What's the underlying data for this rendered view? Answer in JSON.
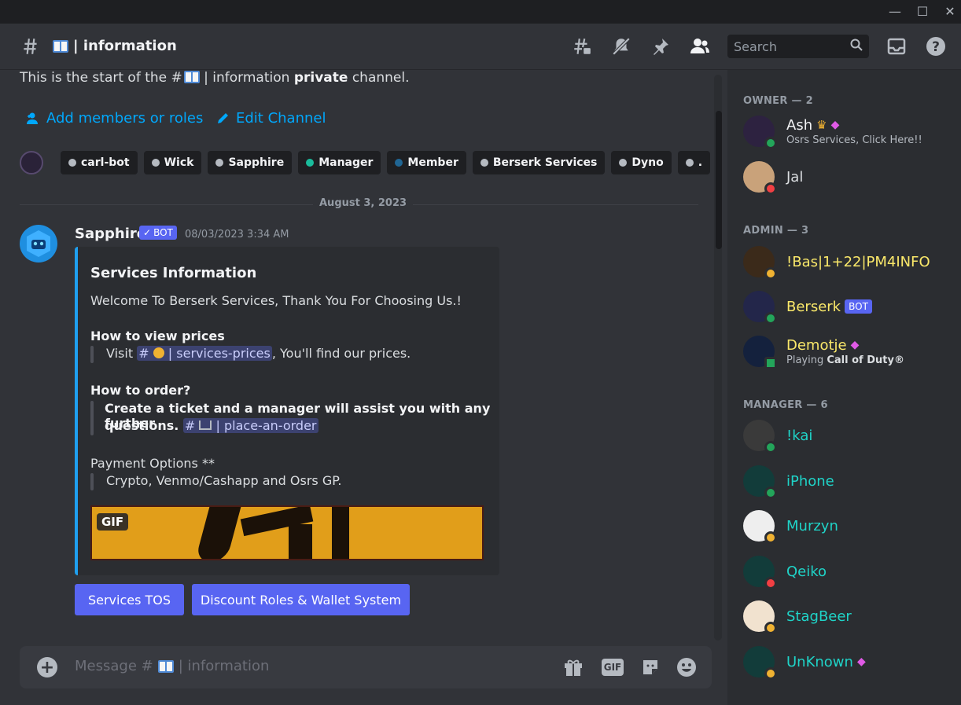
{
  "window": {
    "minimize_icon": "minimize-icon",
    "maximize_icon": "maximize-icon",
    "close_icon": "close-icon"
  },
  "header": {
    "channel_icon": "hashtag-lock-icon",
    "channel_name": "| information",
    "icons": [
      "threads-icon",
      "mute-bell-icon",
      "pin-icon",
      "members-icon"
    ],
    "search_placeholder": "Search",
    "inbox_icon": "inbox-icon",
    "help_icon": "help-icon"
  },
  "intro": {
    "prefix": "This is the start of the #",
    "middle": " | information ",
    "bold": "private",
    "suffix": " channel.",
    "add_members": "Add members or roles",
    "edit_channel": "Edit Channel"
  },
  "roles": [
    {
      "label": "carl-bot",
      "color": "#b5bac1"
    },
    {
      "label": "Wick",
      "color": "#b5bac1"
    },
    {
      "label": "Sapphire",
      "color": "#b5bac1"
    },
    {
      "label": "Manager",
      "color": "#1abc9c"
    },
    {
      "label": "Member",
      "color": "#206694"
    },
    {
      "label": "Berserk Services",
      "color": "#b5bac1"
    },
    {
      "label": "Dyno",
      "color": "#b5bac1"
    },
    {
      "label": ".",
      "color": "#b5bac1"
    }
  ],
  "divider_date": "August 3, 2023",
  "message": {
    "author": "Sapphire",
    "bot_tag": "BOT",
    "timestamp": "08/03/2023 3:34 AM",
    "embed": {
      "title": "Services Information",
      "welcome": "Welcome To Berserk Services, Thank You For Choosing Us.!",
      "prices_heading": "How to view prices",
      "prices_visit": "Visit",
      "prices_channel": "| services-prices",
      "prices_suffix": ", You'll find our prices.",
      "order_heading": "How to order?",
      "order_line1": "Create a ticket and a manager will assist you with any further",
      "order_line2": "questions.",
      "order_channel": "| place-an-order",
      "payment_heading": "Payment Options **",
      "payment_text": "Crypto, Venmo/Cashapp and Osrs GP.",
      "gif_label": "GIF"
    },
    "buttons": [
      "Services TOS",
      "Discount Roles & Wallet System"
    ]
  },
  "composer": {
    "placeholder_prefix": "Message #",
    "placeholder_suffix": "| information",
    "icons": [
      "gift-icon",
      "gif-icon",
      "sticker-icon",
      "emoji-icon"
    ],
    "gif_text": "GIF"
  },
  "members": {
    "groups": [
      {
        "label": "OWNER — 2",
        "members": [
          {
            "name": "Ash",
            "color": "#f2f3f5",
            "sub": "Osrs Services, Click Here!!",
            "status": "online",
            "badges": [
              "crown",
              "gem"
            ]
          },
          {
            "name": "Jal",
            "color": "#dbdee1",
            "sub": "",
            "status": "dnd",
            "badges": []
          }
        ]
      },
      {
        "label": "ADMIN — 3",
        "members": [
          {
            "name": "!Bas|1+22|PM4INFO",
            "color": "#fbe96a",
            "sub": "",
            "status": "idle",
            "badges": []
          },
          {
            "name": "Berserk",
            "color": "#fbe96a",
            "sub": "",
            "status": "online",
            "badges": [
              "bot"
            ]
          },
          {
            "name": "Demotje",
            "color": "#fbe96a",
            "sub_prefix": "Playing ",
            "sub_bold": "Call of Duty®",
            "status": "mobile",
            "badges": [
              "gem"
            ]
          }
        ]
      },
      {
        "label": "MANAGER — 6",
        "members": [
          {
            "name": "!kai",
            "color": "#1fd4c8",
            "status": "online"
          },
          {
            "name": "iPhone",
            "color": "#1fd4c8",
            "status": "online"
          },
          {
            "name": "Murzyn",
            "color": "#1fd4c8",
            "status": "idle"
          },
          {
            "name": "Qeiko",
            "color": "#1fd4c8",
            "status": "dnd"
          },
          {
            "name": "StagBeer",
            "color": "#1fd4c8",
            "status": "idle"
          },
          {
            "name": "UnKnown",
            "color": "#1fd4c8",
            "status": "idle",
            "badges": [
              "gem"
            ]
          }
        ]
      }
    ],
    "bot_tag": "BOT"
  }
}
